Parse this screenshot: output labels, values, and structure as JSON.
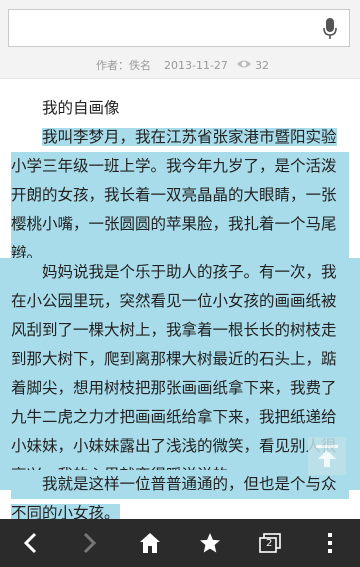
{
  "search": {
    "value": "",
    "placeholder": ""
  },
  "meta": {
    "author": "作者：佚名",
    "date": "2013-11-27",
    "views": "32"
  },
  "article": {
    "title": "我的自画像",
    "p1_lines": [
      "我叫李梦月，我在江苏省张家港市暨阳实验",
      "小学三年级一班上学。我今年九岁了，是个活泼",
      "开朗的女孩，我长着一双亮晶晶的大眼睛，一张",
      "樱桃小嘴，一张圆圆的苹果脸，我扎着一个马尾",
      "辫。"
    ],
    "p2_lines": [
      "妈妈说我是个乐于助人的孩子。有一次，我",
      "在小公园里玩，突然看见一位小女孩的画画纸被",
      "风刮到了一棵大树上，我拿着一根长长的树枝走",
      "到那大树下，爬到离那棵大树最近的石头上，踮",
      "着脚尖，想用树枝把那张画画纸拿下来，我费了",
      "九牛二虎之力才把画画纸给拿下来，我把纸递给",
      "小妹妹，小妹妹露出了浅浅的微笑，看见别人很",
      "高兴，我的心里就变得暖洋洋的。"
    ],
    "p3_lines": [
      "我就是这样一位普普通通的，但也是个与众",
      "不同的小女孩。"
    ]
  },
  "toolbar": {
    "tab_count": "2"
  },
  "colors": {
    "highlight": "#a8dcea",
    "toolbar": "#2b2b2b"
  }
}
